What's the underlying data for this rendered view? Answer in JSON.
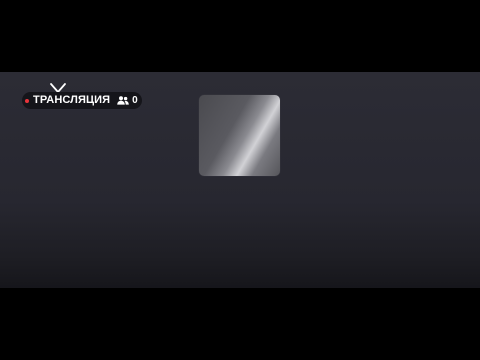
{
  "broadcast": {
    "live_label": "ТРАНСЛЯЦИЯ",
    "viewer_count": "0",
    "live_dot_color": "#e8343b",
    "icons": {
      "antenna": "antenna-icon",
      "viewers": "users-icon"
    }
  },
  "colors": {
    "player_background": "#2c2c35",
    "letterbox": "#000000",
    "badge_background": "#15151a"
  }
}
